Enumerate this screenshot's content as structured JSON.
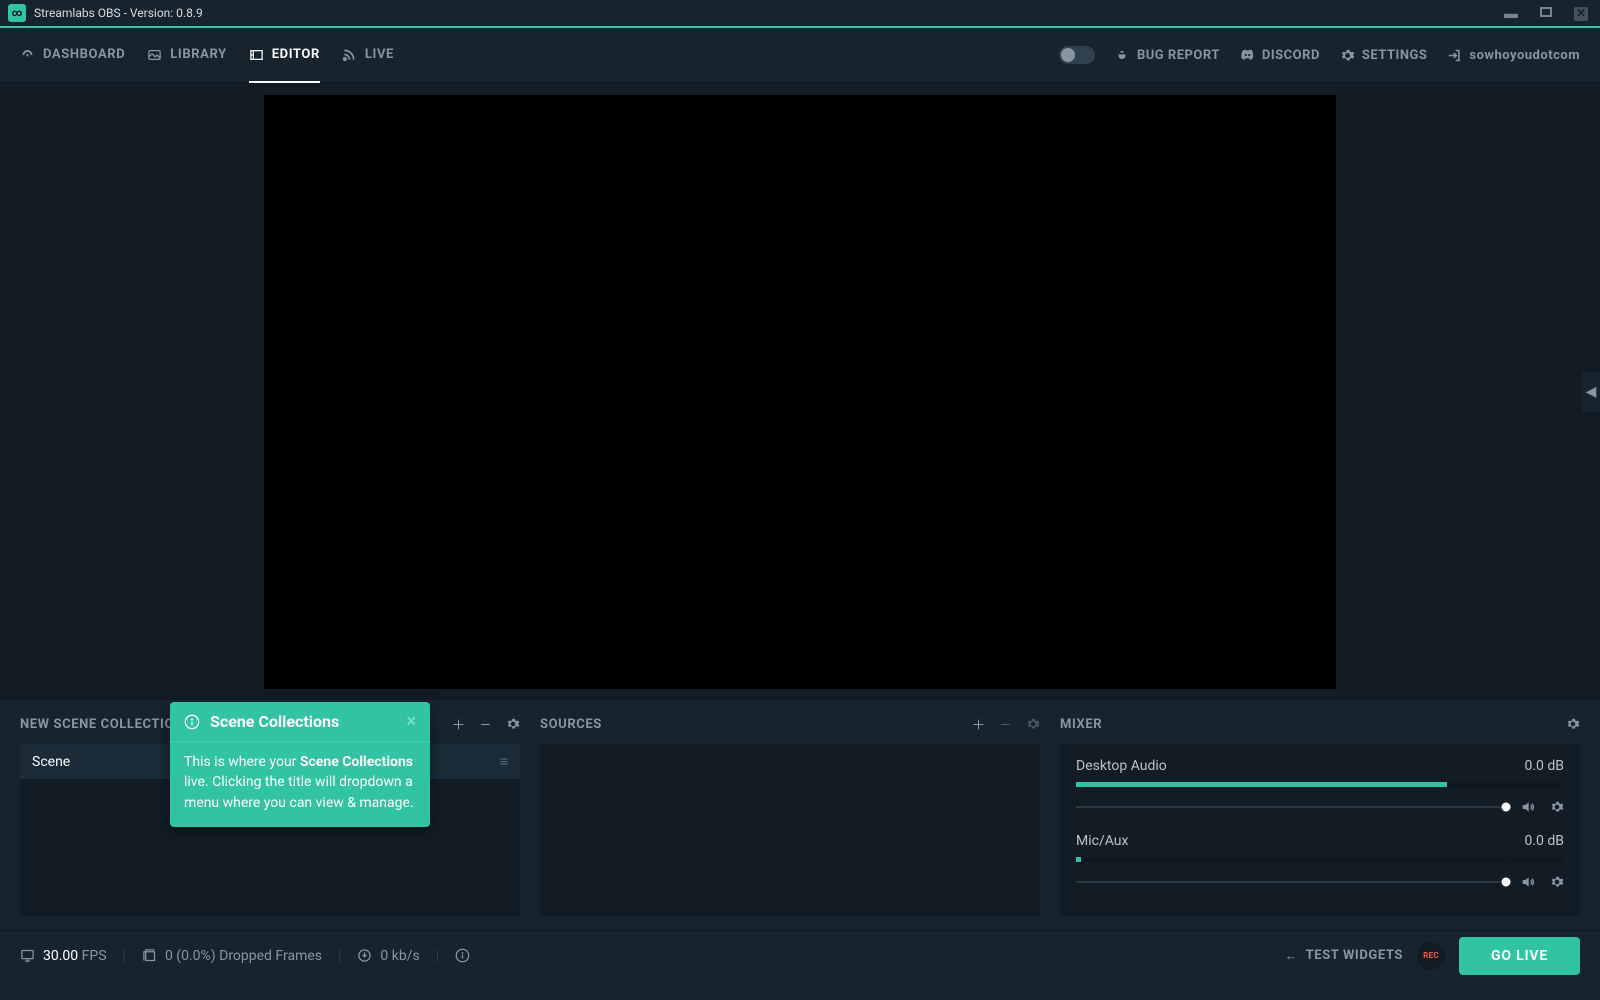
{
  "title": "Streamlabs OBS - Version: 0.8.9",
  "nav": {
    "dashboard": "Dashboard",
    "library": "Library",
    "editor": "Editor",
    "live": "Live"
  },
  "navRight": {
    "bugReport": "Bug Report",
    "discord": "Discord",
    "settings": "Settings",
    "user": "sowhoyoudotcom"
  },
  "panels": {
    "sceneCollection": "New Scene Collection",
    "sources": "Sources",
    "mixer": "Mixer"
  },
  "scenes": [
    {
      "name": "Scene"
    }
  ],
  "mixer": [
    {
      "name": "Desktop Audio",
      "db": "0.0 dB"
    },
    {
      "name": "Mic/Aux",
      "db": "0.0 dB"
    }
  ],
  "tooltip": {
    "title": "Scene Collections",
    "bodyPrefix": "This is where your ",
    "bodyBold": "Scene Collections",
    "bodySuffix": " live. Clicking the title will dropdown a menu where you can view & manage."
  },
  "footer": {
    "fpsValue": "30.00",
    "fpsLabel": "FPS",
    "dropped": "0 (0.0%) Dropped Frames",
    "bitrate": "0 kb/s",
    "testWidgets": "Test Widgets",
    "rec": "REC",
    "goLive": "Go Live"
  }
}
